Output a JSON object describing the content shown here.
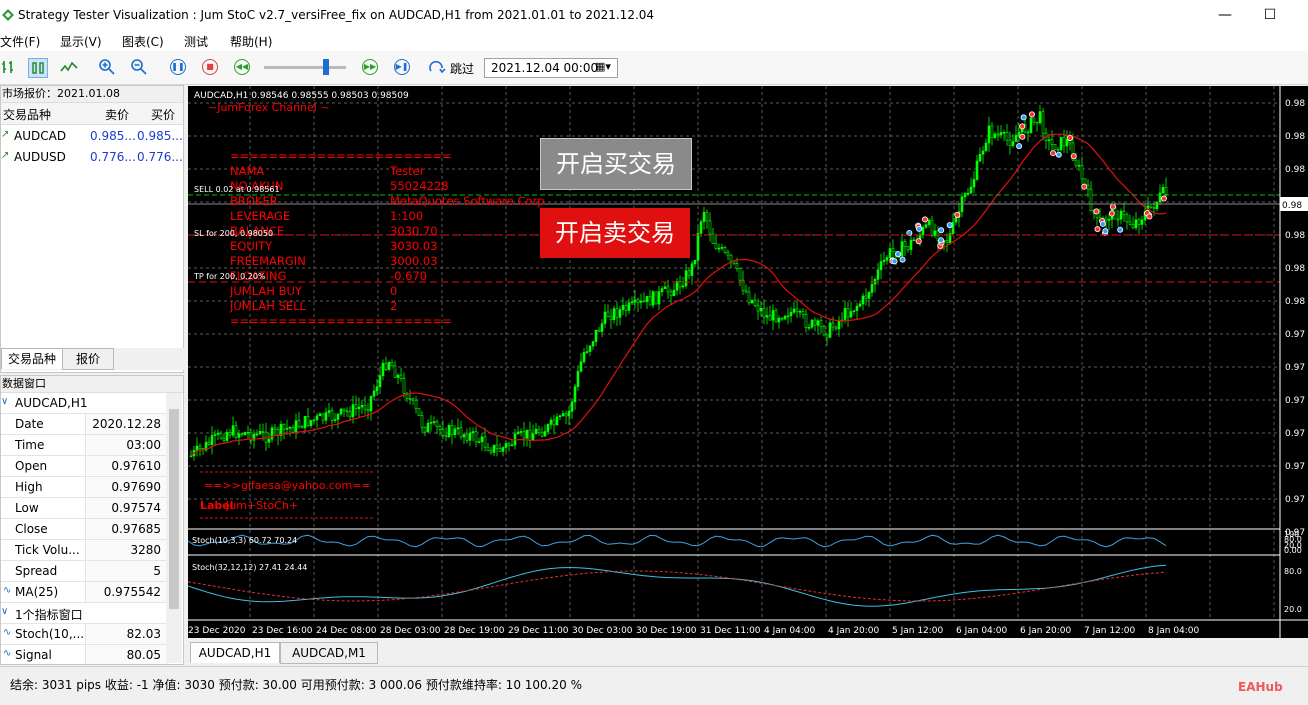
{
  "window": {
    "title": "Strategy Tester Visualization : Jum StoC v2.7_versiFree_fix on AUDCAD,H1 from 2021.01.01 to 2021.12.04",
    "minimize": "—",
    "maximize": "☐"
  },
  "menu": [
    "文件(F)",
    "显示(V)",
    "图表(C)",
    "测试",
    "帮助(H)"
  ],
  "toolbar": {
    "skip_label": "跳过",
    "date_value": "2021.12.04 00:00"
  },
  "market_watch": {
    "title": "市场报价：2021.01.08",
    "columns": [
      "交易品种",
      "卖价",
      "买价"
    ],
    "rows": [
      {
        "symbol": "AUDCAD",
        "bid": "0.985...",
        "ask": "0.985..."
      },
      {
        "symbol": "AUDUSD",
        "bid": "0.776...",
        "ask": "0.776..."
      }
    ],
    "tabs": [
      "交易品种",
      "报价"
    ]
  },
  "data_window": {
    "title": "数据窗口",
    "group": "AUDCAD,H1",
    "rows": [
      {
        "label": "Date",
        "value": "2020.12.28"
      },
      {
        "label": "Time",
        "value": "03:00"
      },
      {
        "label": "Open",
        "value": "0.97610"
      },
      {
        "label": "High",
        "value": "0.97690"
      },
      {
        "label": "Low",
        "value": "0.97574"
      },
      {
        "label": "Close",
        "value": "0.97685"
      },
      {
        "label": "Tick Volu...",
        "value": "3280"
      },
      {
        "label": "Spread",
        "value": "5"
      }
    ],
    "ma_label": "MA(25)",
    "ma_value": "0.975542",
    "indicator_group": "1个指标窗口",
    "stoch_label": "Stoch(10,...",
    "stoch_value": "82.03",
    "signal_label": "Signal",
    "signal_value": "80.05"
  },
  "chart": {
    "header": "AUDCAD,H1  0.98546 0.98555 0.98503 0.98509",
    "channel": "~JumForex Channel ~",
    "info_lines": [
      {
        "label": "=======================",
        "value": ""
      },
      {
        "label": "NAMA",
        "value": "Tester"
      },
      {
        "label": "NO AKUN",
        "value": "55024228"
      },
      {
        "label": "BROKER",
        "value": "MetaQuotes Software Corp."
      },
      {
        "label": "LEVERAGE",
        "value": "1:100"
      },
      {
        "label": "BALANCE",
        "value": "3030.70"
      },
      {
        "label": "EQUITY",
        "value": "3030.03"
      },
      {
        "label": "FREEMARGIN",
        "value": "3000.03"
      },
      {
        "label": "FLOATING",
        "value": "-0.670"
      },
      {
        "label": "JUMLAH BUY",
        "value": "0"
      },
      {
        "label": "JUMLAH SELL",
        "value": "2"
      },
      {
        "label": "=======================",
        "value": ""
      }
    ],
    "sell_line": "SELL 0.02 at 0.98561",
    "sl_line": "SL for 200, 0.98050",
    "tp_line": "TP for 200, 0.20%",
    "buy_button": "开启买交易",
    "sell_button": "开启卖交易",
    "email": "==>>gifaesa@yahoo.com==",
    "label_text": "Label",
    "jum_text": "Jum+StoCh+",
    "price_labels": [
      "0.98",
      "0.98",
      "0.98",
      "0.98",
      "0.98",
      "0.98",
      "0.98",
      "0.97",
      "0.97",
      "0.97",
      "0.97",
      "0.97",
      "0.97",
      "0.97"
    ],
    "current_price": "0.98",
    "stoch1_title": "Stoch(10,3,3) 60.72 70.24",
    "stoch1_scale": [
      "100",
      "80.0",
      "20.0",
      "0.00"
    ],
    "stoch2_title": "Stoch(32,12,12) 27.41 24.44",
    "stoch2_scale": [
      "80.0",
      "20.0"
    ],
    "time_labels": [
      "23 Dec 2020",
      "23 Dec 16:00",
      "24 Dec 08:00",
      "28 Dec 03:00",
      "28 Dec 19:00",
      "29 Dec 11:00",
      "30 Dec 03:00",
      "30 Dec 19:00",
      "31 Dec 11:00",
      "4 Jan 04:00",
      "4 Jan 20:00",
      "5 Jan 12:00",
      "6 Jan 04:00",
      "6 Jan 20:00",
      "7 Jan 12:00",
      "8 Jan 04:00"
    ],
    "tabs": [
      "AUDCAD,H1",
      "AUDCAD,M1"
    ],
    "colors": {
      "bull": "#00ff00",
      "ma": "#ff2020",
      "text": "#ff0000",
      "grid": "#5a5a5a"
    }
  },
  "status": {
    "text": "结余: 3031 pips    收益: -1    净值: 3030    预付款: 30.00    可用预付款: 3 000.06    预付款维持率: 10 100.20 %",
    "brand": "EAHub"
  }
}
